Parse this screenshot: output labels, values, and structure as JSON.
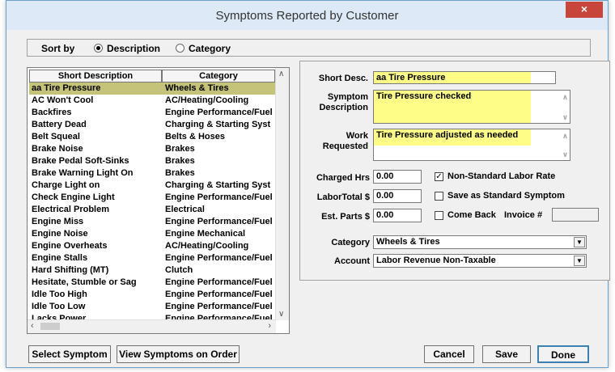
{
  "window": {
    "title": "Symptoms Reported by Customer",
    "close": "×"
  },
  "sort": {
    "label": "Sort by",
    "option_description": "Description",
    "option_category": "Category",
    "selected": "Description"
  },
  "list": {
    "columns": [
      "Short Description",
      "Category"
    ],
    "rows": [
      [
        "aa Tire Pressure",
        "Wheels & Tires"
      ],
      [
        "AC Won't Cool",
        "AC/Heating/Cooling"
      ],
      [
        "Backfires",
        "Engine Performance/Fuel"
      ],
      [
        "Battery Dead",
        "Charging & Starting Syst"
      ],
      [
        "Belt Squeal",
        "Belts & Hoses"
      ],
      [
        "Brake Noise",
        "Brakes"
      ],
      [
        "Brake Pedal Soft-Sinks",
        "Brakes"
      ],
      [
        "Brake Warning Light On",
        "Brakes"
      ],
      [
        "Charge Light on",
        "Charging & Starting Syst"
      ],
      [
        "Check Engine Light",
        "Engine Performance/Fuel"
      ],
      [
        "Electrical Problem",
        "Electrical"
      ],
      [
        "Engine Miss",
        "Engine Performance/Fuel"
      ],
      [
        "Engine Noise",
        "Engine Mechanical"
      ],
      [
        "Engine Overheats",
        "AC/Heating/Cooling"
      ],
      [
        "Engine Stalls",
        "Engine Performance/Fuel"
      ],
      [
        "Hard Shifting (MT)",
        "Clutch"
      ],
      [
        "Hesitate, Stumble or Sag",
        "Engine Performance/Fuel"
      ],
      [
        "Idle Too High",
        "Engine Performance/Fuel"
      ],
      [
        "Idle Too Low",
        "Engine Performance/Fuel"
      ],
      [
        "Lacks Power",
        "Engine Performance/Fuel"
      ]
    ],
    "selected_index": 0
  },
  "form": {
    "short_desc_label": "Short Desc.",
    "short_desc_value": "aa Tire Pressure",
    "symptom_desc_label": "Symptom Description",
    "symptom_desc_value": "Tire Pressure checked",
    "work_requested_label": "Work Requested",
    "work_requested_value": "Tire Pressure adjusted as needed",
    "charged_hrs_label": "Charged Hrs",
    "charged_hrs_value": "0.00",
    "labor_total_label": "LaborTotal $",
    "labor_total_value": "0.00",
    "est_parts_label": "Est. Parts $",
    "est_parts_value": "0.00",
    "non_standard_label": "Non-Standard Labor Rate",
    "non_standard_checked": true,
    "save_standard_label": "Save as Standard Symptom",
    "come_back_label": "Come Back",
    "invoice_label": "Invoice #",
    "invoice_value": "",
    "category_label": "Category",
    "category_value": "Wheels & Tires",
    "account_label": "Account",
    "account_value": "Labor Revenue Non-Taxable"
  },
  "buttons": {
    "select_symptom": "Select Symptom",
    "view_symptoms": "View Symptoms on Order",
    "cancel": "Cancel",
    "save": "Save",
    "done": "Done"
  },
  "colors": {
    "selected_row": "#c5c27a",
    "highlight": "#fdfd88",
    "close": "#c7453b"
  }
}
